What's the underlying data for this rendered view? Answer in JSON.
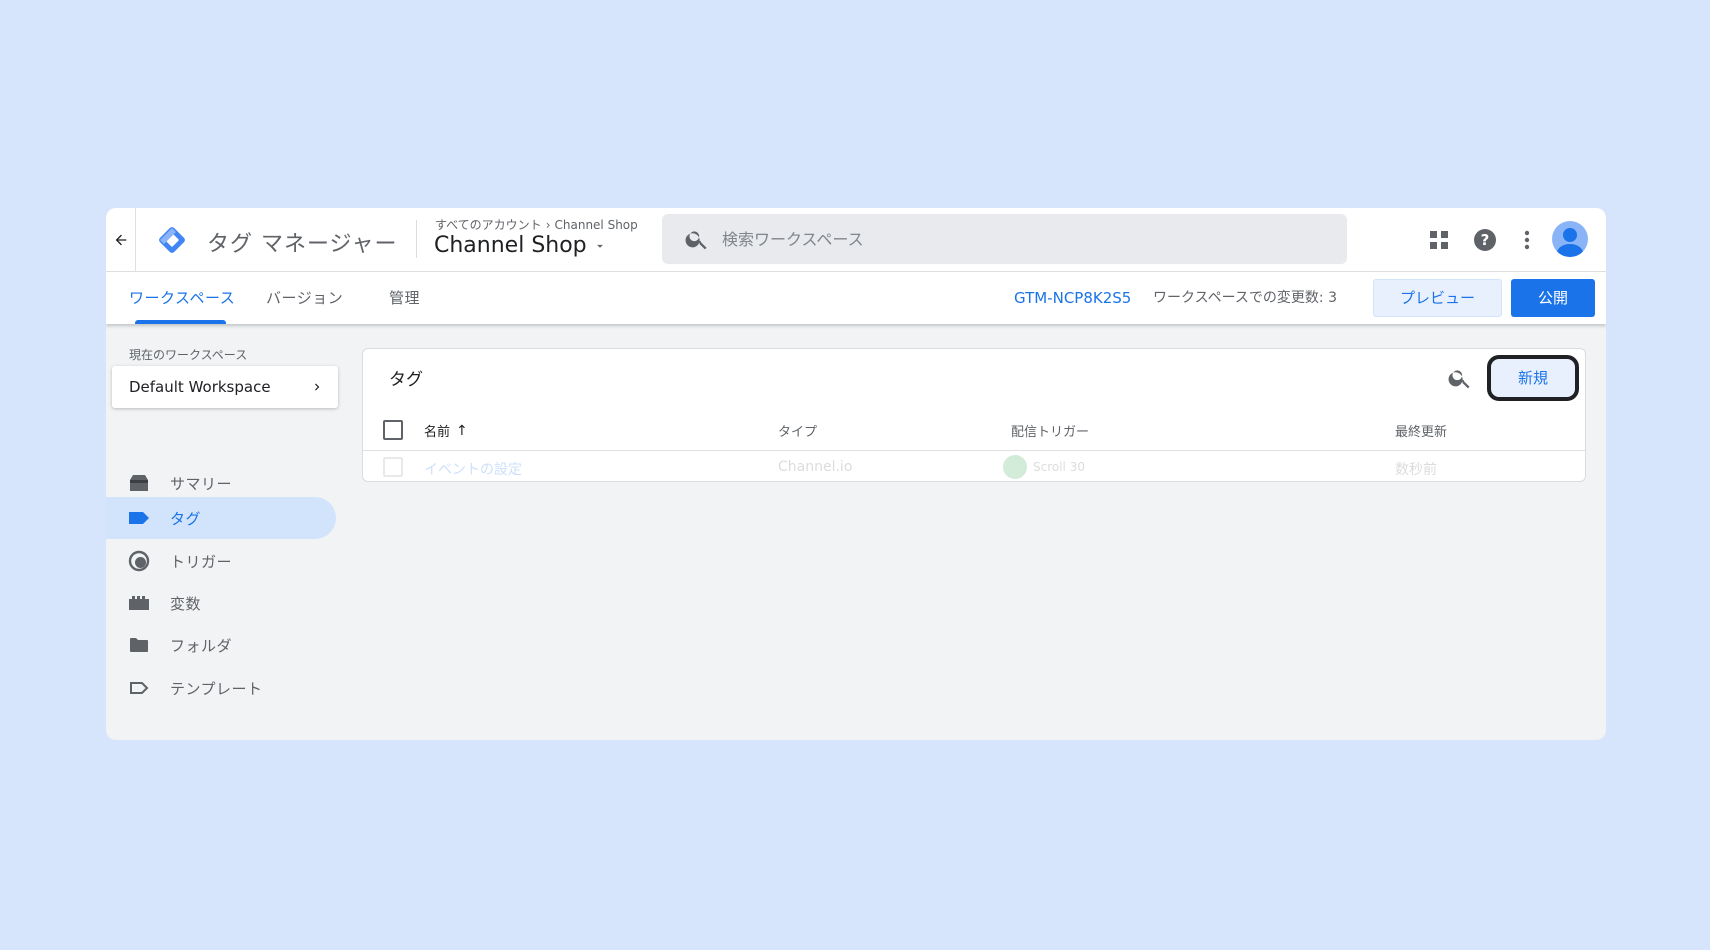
{
  "header": {
    "product_name": "タグ マネージャー",
    "breadcrumb": {
      "parent": "すべてのアカウント",
      "separator": "›",
      "current": "Channel Shop"
    },
    "container_name": "Channel Shop",
    "search_placeholder": "検索ワークスペース"
  },
  "toolbar": {
    "tabs": [
      {
        "label": "ワークスペース",
        "active": true
      },
      {
        "label": "バージョン",
        "active": false
      },
      {
        "label": "管理",
        "active": false
      }
    ],
    "container_id": "GTM-NCP8K2S5",
    "changes_text": "ワークスペースでの変更数: 3",
    "preview_label": "プレビュー",
    "publish_label": "公開"
  },
  "sidebar": {
    "current_workspace_label": "現在のワークスペース",
    "workspace_name": "Default Workspace",
    "items": [
      {
        "label": "サマリー",
        "icon": "summary-icon",
        "active": false
      },
      {
        "label": "タグ",
        "icon": "tag-icon",
        "active": true
      },
      {
        "label": "トリガー",
        "icon": "trigger-icon",
        "active": false
      },
      {
        "label": "変数",
        "icon": "variable-icon",
        "active": false
      },
      {
        "label": "フォルダ",
        "icon": "folder-icon",
        "active": false
      },
      {
        "label": "テンプレート",
        "icon": "template-icon",
        "active": false
      }
    ]
  },
  "main": {
    "title": "タグ",
    "new_button_label": "新規",
    "columns": {
      "name": "名前",
      "sort_indicator": "↑",
      "type": "タイプ",
      "trigger": "配信トリガー",
      "last_updated": "最終更新"
    },
    "rows": [
      {
        "name": "イベントの設定",
        "type": "Channel.io",
        "trigger": "Scroll 30",
        "last_updated": "数秒前"
      }
    ]
  },
  "colors": {
    "accent": "#1a73e8",
    "background": "#d6e4fc",
    "active_nav": "#d2e3fc"
  }
}
